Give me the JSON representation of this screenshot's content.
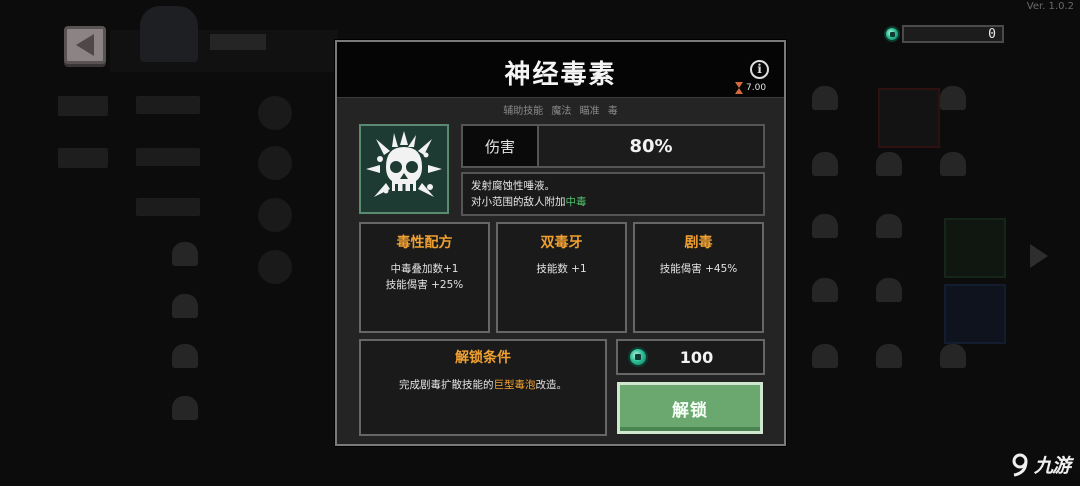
{
  "version": "Ver. 1.0.2",
  "currency": {
    "icon": "gem-icon",
    "amount": "0"
  },
  "skill": {
    "name": "神经毒素",
    "cooldown": "7.00",
    "tags": "辅助技能 魔法 瞄准 毒",
    "damage_label": "伤害",
    "damage_value": "80%",
    "desc_line1": "发射腐蚀性唾液。",
    "desc_line2_prefix": "对小范围的敌人附加",
    "desc_line2_highlight": "中毒"
  },
  "upgrades": [
    {
      "title": "毒性配方",
      "effect_1": "中毒叠加数+1",
      "effect_2": "技能偈害 +25%"
    },
    {
      "title": "双毒牙",
      "effect_1": "技能数 +1",
      "effect_2": ""
    },
    {
      "title": "剧毒",
      "effect_1": "技能偈害 +45%",
      "effect_2": ""
    }
  ],
  "unlock_condition": {
    "title": "解锁条件",
    "text_prefix": "完成剧毒扩散技能的",
    "text_highlight": "巨型毒泡",
    "text_suffix": "改造。"
  },
  "cost": "100",
  "unlock_button": "解锁",
  "watermark": "九游",
  "colors": {
    "accent_orange": "#f0a030",
    "poison_green": "#4fc26a",
    "button_green": "#6aa870"
  }
}
